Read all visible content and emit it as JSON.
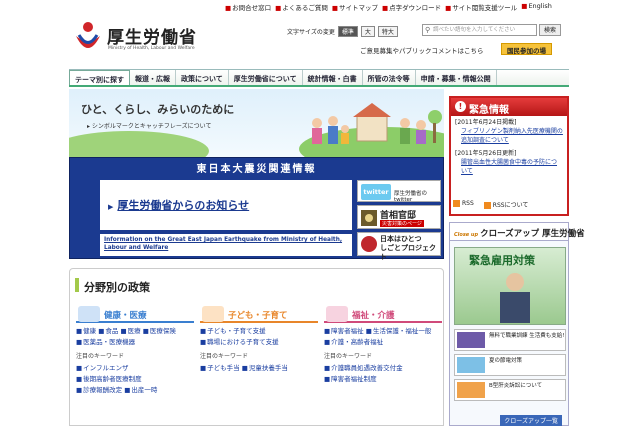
{
  "top_links": [
    "お問合せ窓口",
    "よくあるご質問",
    "サイトマップ",
    "点字ダウンロード",
    "サイト閲覧支援ツール",
    "English"
  ],
  "logo": {
    "title": "厚生労働省",
    "subtitle": "Ministry of Health, Labour and Welfare"
  },
  "font_size": {
    "label": "文字サイズの変更",
    "options": [
      "標準",
      "大",
      "特大"
    ]
  },
  "search": {
    "placeholder": "調べたい語句を入力してください",
    "button": "検索"
  },
  "opinion_link": "ご意見募集やパブリックコメントはこちら",
  "participate_button": "国民参加の場",
  "nav": [
    "テーマ別に探す",
    "報道・広報",
    "政策について",
    "厚生労働省について",
    "統計情報・白書",
    "所管の法令等",
    "申請・募集・情報公開"
  ],
  "hero": {
    "text": "ひと、くらし、みらいのために",
    "link": "シンボルマークとキャッチフレーズについて"
  },
  "disaster": {
    "title": "東日本大震災関連情報",
    "notice": "厚生労働省からのお知らせ",
    "info_en": "Information on the Great East Japan Earthquake from Ministry of Health, Labour and Welfare",
    "twitter_logo": "twitter",
    "twitter_label": "厚生労働省のtwitter",
    "kantei_title": "首相官邸",
    "kantei_sub": "災害対策のページ",
    "nihon_line1": "日本はひとつ",
    "nihon_line2": "しごとプロジェクト"
  },
  "policy": {
    "title": "分野別の政策",
    "keyword_label": "注目のキーワード",
    "columns": [
      {
        "title": "健康・医療",
        "color": "#3a7fd0",
        "links": [
          "健康",
          "食品",
          "医療",
          "医療保険",
          "医薬品・医療機器"
        ],
        "keywords": [
          "インフルエンザ",
          "後期高齢者医療制度",
          "診療報酬改定",
          "出産一時"
        ]
      },
      {
        "title": "子ども・子育て",
        "color": "#e8862a",
        "links": [
          "子ども・子育て支援",
          "職場における子育て支援"
        ],
        "keywords": [
          "子ども手当",
          "児童扶養手当"
        ]
      },
      {
        "title": "福祉・介護",
        "color": "#d04a7a",
        "links": [
          "障害者福祉",
          "生活保護・福祉一般",
          "介護・高齢者福祉"
        ],
        "keywords": [
          "介護職員処遇改善交付金",
          "障害者福祉制度"
        ]
      }
    ]
  },
  "emergency": {
    "title": "緊急情報",
    "items": [
      {
        "date": "[2011年6月24日掲載]",
        "text": "フィブリノゲン製剤納入先医療機関の追加調査について"
      },
      {
        "date": "[2011年5月26日更新]",
        "text": "腸管出血性大腸菌食中毒の予防について"
      }
    ],
    "rss": [
      "RSS",
      "RSSについて"
    ]
  },
  "closeup": {
    "prefix": "Close up",
    "title": "クローズアップ 厚生労働省",
    "banner": "緊急雇用対策",
    "rows": [
      "無料で職業訓練 生活費も支給!",
      "夏の節電対策",
      "B型肝炎訴訟について"
    ],
    "more": "クローズアップ一覧"
  }
}
